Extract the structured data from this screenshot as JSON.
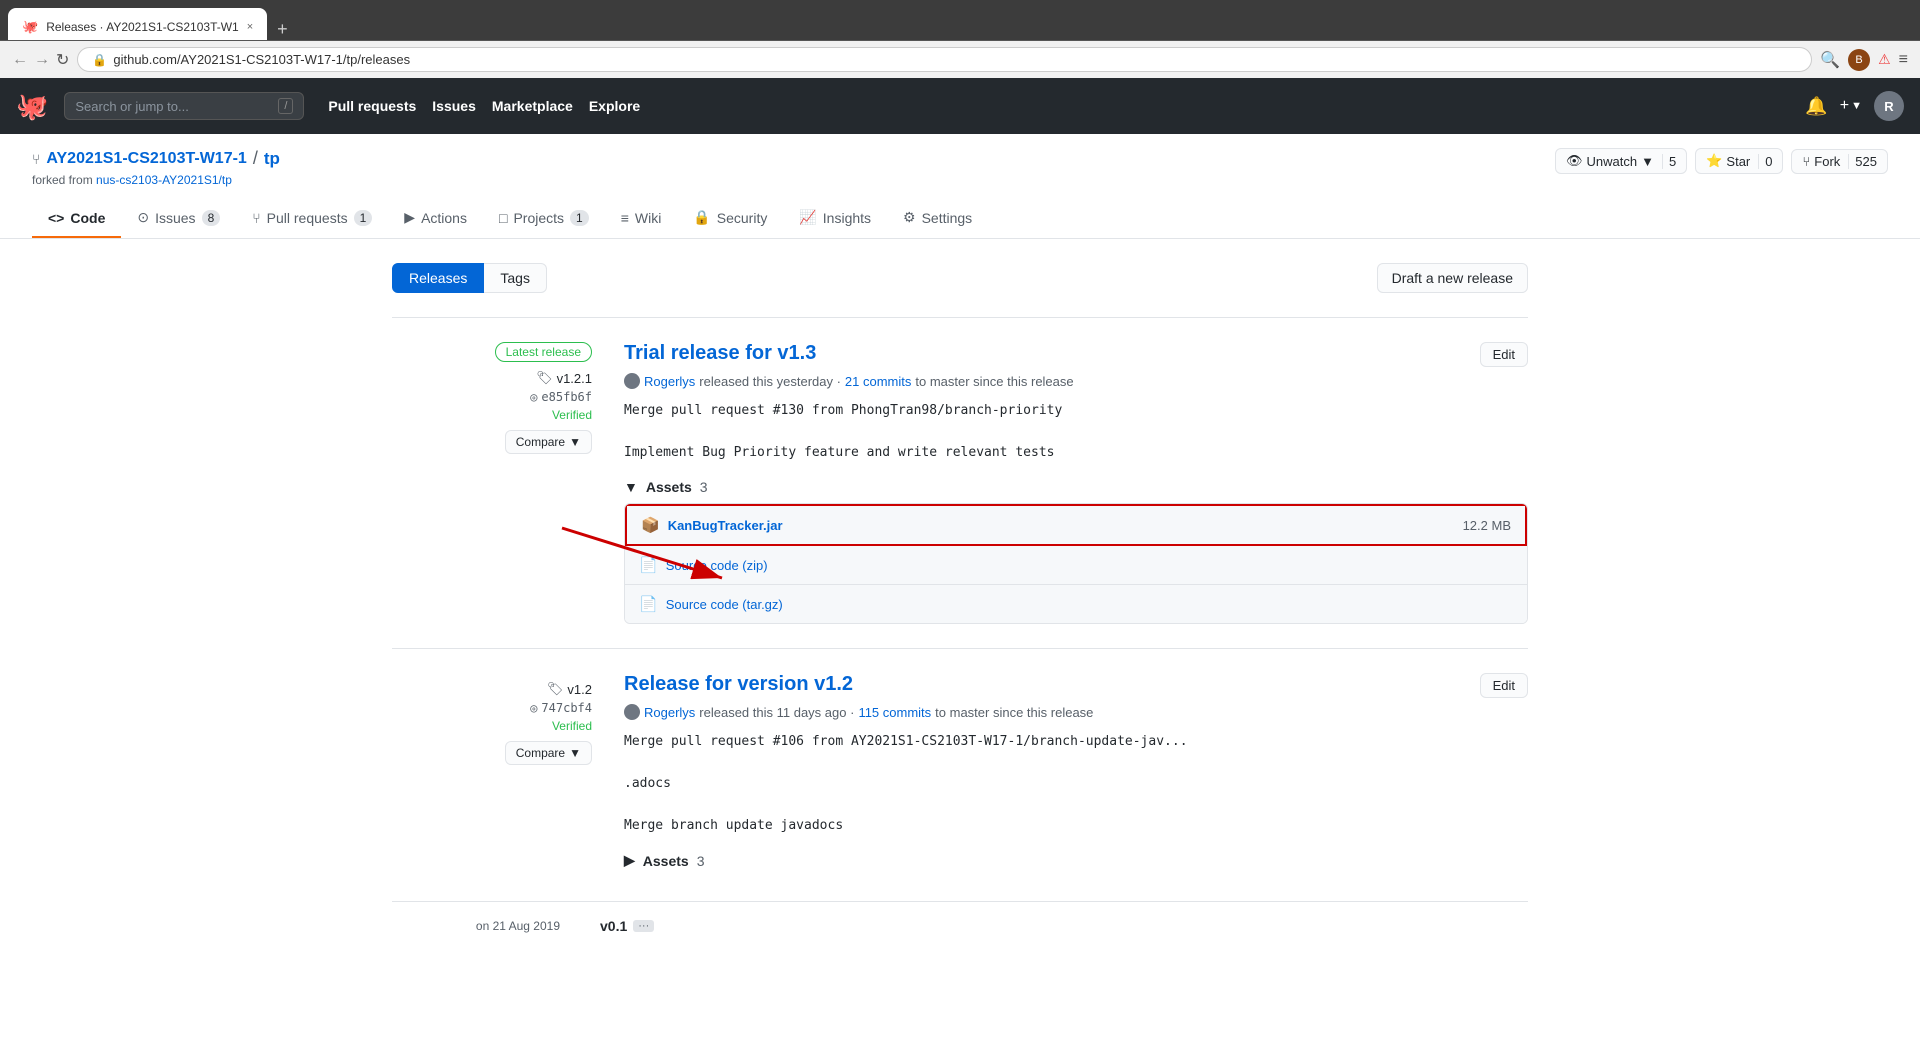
{
  "browser": {
    "tab_title": "Releases · AY2021S1-CS2103T-W1",
    "tab_close": "×",
    "tab_new": "+",
    "back": "←",
    "forward": "→",
    "refresh": "↻",
    "url": "github.com/AY2021S1-CS2103T-W17-1/tp/releases",
    "menu": "≡"
  },
  "github_nav": {
    "search_placeholder": "Search or jump to...",
    "slash_key": "/",
    "links": [
      "Pull requests",
      "Issues",
      "Marketplace",
      "Explore"
    ],
    "notification_icon": "🔔",
    "add_icon": "+",
    "avatar_text": "R"
  },
  "repo": {
    "org": "AY2021S1-CS2103T-W17-1",
    "separator": "/",
    "name": "tp",
    "forked_from": "forked from nus-cs2103-AY2021S1/tp",
    "forked_from_url": "nus-cs2103-AY2021S1/tp",
    "watch_label": "Unwatch",
    "watch_count": "5",
    "star_label": "Star",
    "star_count": "0",
    "fork_label": "Fork",
    "fork_count": "525"
  },
  "tabs": [
    {
      "icon": "<>",
      "label": "Code",
      "active": false,
      "badge": null
    },
    {
      "icon": "●",
      "label": "Issues",
      "active": false,
      "badge": "8"
    },
    {
      "icon": "⑂",
      "label": "Pull requests",
      "active": false,
      "badge": "1"
    },
    {
      "icon": "▶",
      "label": "Actions",
      "active": false,
      "badge": null
    },
    {
      "icon": "□",
      "label": "Projects",
      "active": false,
      "badge": "1"
    },
    {
      "icon": "≡",
      "label": "Wiki",
      "active": false,
      "badge": null
    },
    {
      "icon": "🔒",
      "label": "Security",
      "active": false,
      "badge": null
    },
    {
      "icon": "📈",
      "label": "Insights",
      "active": false,
      "badge": null
    },
    {
      "icon": "⚙",
      "label": "Settings",
      "active": false,
      "badge": null
    }
  ],
  "releases_page": {
    "releases_btn": "Releases",
    "tags_btn": "Tags",
    "draft_btn": "Draft a new release"
  },
  "releases": [
    {
      "latest": true,
      "latest_label": "Latest release",
      "tag": "v1.2.1",
      "commit": "e85fb6f",
      "verified": "Verified",
      "compare_label": "Compare",
      "title": "Trial release for v1.3",
      "title_href": "#",
      "released_by": "Rogerlys",
      "released_time": "released this yesterday",
      "commits_link": "21 commits",
      "commits_to": "to master since this release",
      "description_lines": [
        "Merge pull request #130 from PhongTran98/branch-priority",
        "",
        "Implement Bug Priority feature and write relevant tests"
      ],
      "assets_label": "Assets",
      "assets_count": "3",
      "assets_expanded": true,
      "assets": [
        {
          "name": "KanBugTracker.jar",
          "size": "12.2 MB",
          "icon": "📦",
          "highlighted": true
        },
        {
          "name": "Source code (zip)",
          "size": null,
          "icon": "📄",
          "highlighted": false
        },
        {
          "name": "Source code (tar.gz)",
          "size": null,
          "icon": "📄",
          "highlighted": false
        }
      ],
      "edit_label": "Edit"
    },
    {
      "latest": false,
      "tag": "v1.2",
      "commit": "747cbf4",
      "verified": "Verified",
      "compare_label": "Compare",
      "title": "Release for version v1.2",
      "title_href": "#",
      "released_by": "Rogerlys",
      "released_time": "released this 11 days ago",
      "commits_link": "115 commits",
      "commits_to": "to master since this release",
      "description_lines": [
        "Merge pull request #106 from AY2021S1-CS2103T-W17-1/branch-update-jav...",
        "",
        ".adocs",
        "",
        "Merge branch update javadocs"
      ],
      "assets_label": "Assets",
      "assets_count": "3",
      "assets_expanded": false,
      "edit_label": "Edit"
    }
  ],
  "v01": {
    "tag": "v0.1",
    "date": "on 21 Aug 2019",
    "ellipsis": "..."
  }
}
